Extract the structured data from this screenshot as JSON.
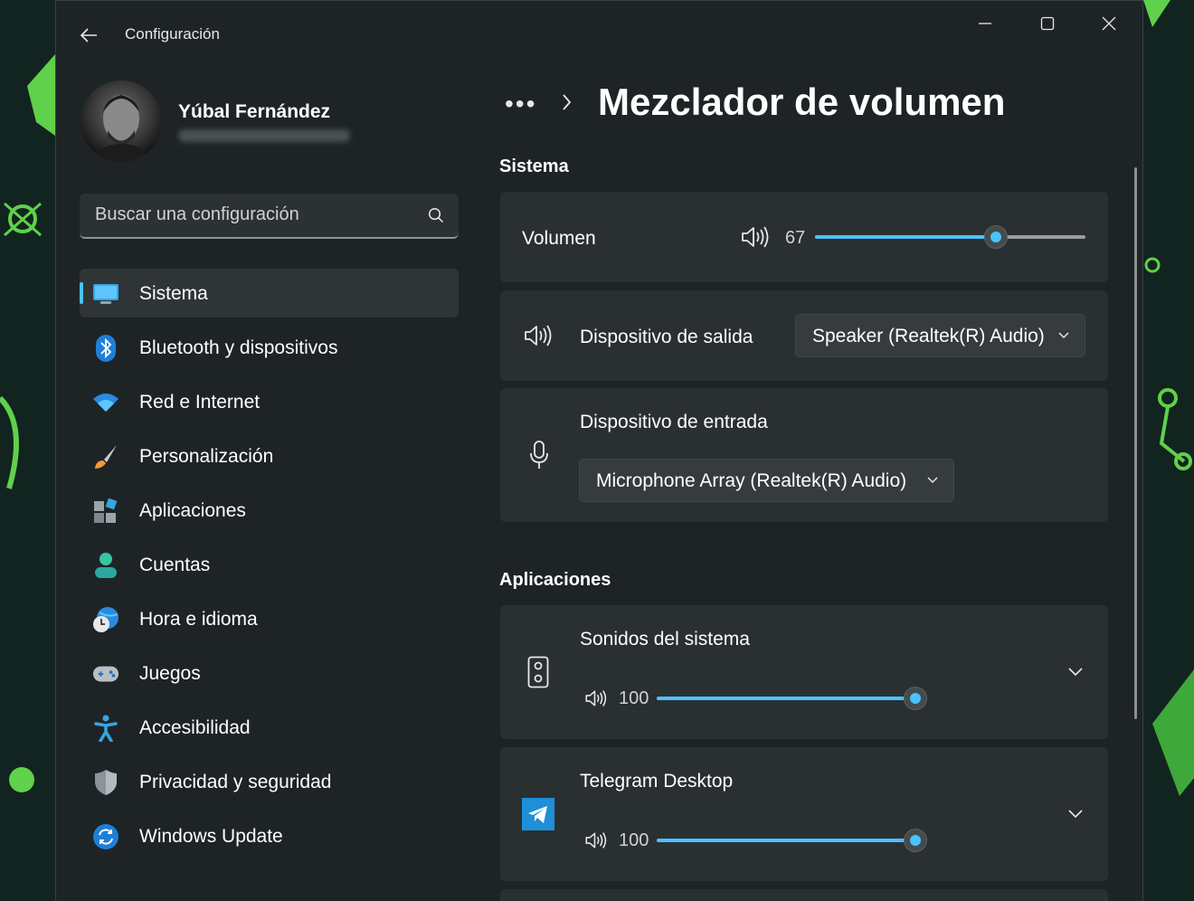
{
  "window": {
    "app_title": "Configuración"
  },
  "profile": {
    "name": "Yúbal Fernández"
  },
  "search": {
    "placeholder": "Buscar una configuración"
  },
  "sidebar": {
    "items": [
      {
        "label": "Sistema",
        "icon": "monitor-icon",
        "active": true
      },
      {
        "label": "Bluetooth y dispositivos",
        "icon": "bluetooth-icon"
      },
      {
        "label": "Red e Internet",
        "icon": "wifi-icon"
      },
      {
        "label": "Personalización",
        "icon": "brush-icon"
      },
      {
        "label": "Aplicaciones",
        "icon": "apps-icon"
      },
      {
        "label": "Cuentas",
        "icon": "account-icon"
      },
      {
        "label": "Hora e idioma",
        "icon": "clock-globe-icon"
      },
      {
        "label": "Juegos",
        "icon": "gamepad-icon"
      },
      {
        "label": "Accesibilidad",
        "icon": "accessibility-icon"
      },
      {
        "label": "Privacidad y seguridad",
        "icon": "shield-icon"
      },
      {
        "label": "Windows Update",
        "icon": "update-icon"
      }
    ]
  },
  "breadcrumb": {
    "dots": "•••",
    "title": "Mezclador de volumen"
  },
  "system_section": {
    "title": "Sistema",
    "volume": {
      "label": "Volumen",
      "value": "67",
      "level": 0.67
    },
    "output": {
      "label": "Dispositivo de salida",
      "selected": "Speaker (Realtek(R) Audio)"
    },
    "input": {
      "label": "Dispositivo de entrada",
      "selected": "Microphone Array (Realtek(R) Audio)"
    }
  },
  "apps_section": {
    "title": "Aplicaciones",
    "apps": [
      {
        "name": "Sonidos del sistema",
        "value": "100",
        "level": 1.0,
        "icon": "speaker-device-icon"
      },
      {
        "name": "Telegram Desktop",
        "value": "100",
        "level": 1.0,
        "icon": "telegram-icon"
      }
    ]
  },
  "colors": {
    "accent": "#4cc2ff",
    "window_bg": "#1e2426",
    "card_bg": "#2a3032"
  }
}
